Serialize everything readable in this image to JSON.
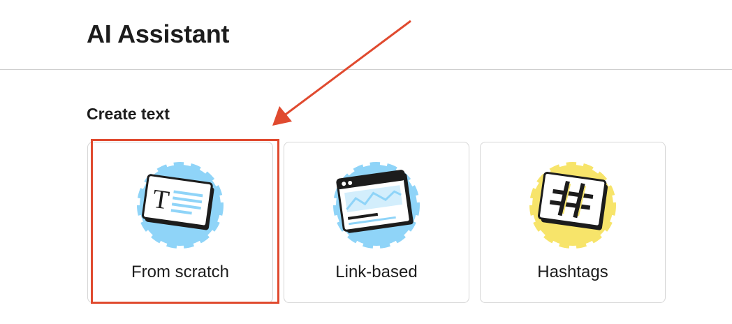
{
  "header": {
    "title": "AI Assistant"
  },
  "section": {
    "title": "Create text"
  },
  "cards": [
    {
      "label": "From scratch",
      "icon": "text-document-icon",
      "accent_color": "#8fd4f8",
      "selected": true
    },
    {
      "label": "Link-based",
      "icon": "browser-window-icon",
      "accent_color": "#8fd4f8",
      "selected": false
    },
    {
      "label": "Hashtags",
      "icon": "hashtag-icon",
      "accent_color": "#f7e46a",
      "selected": false
    }
  ],
  "annotation": {
    "color": "#e04a2f",
    "target": "From scratch"
  }
}
